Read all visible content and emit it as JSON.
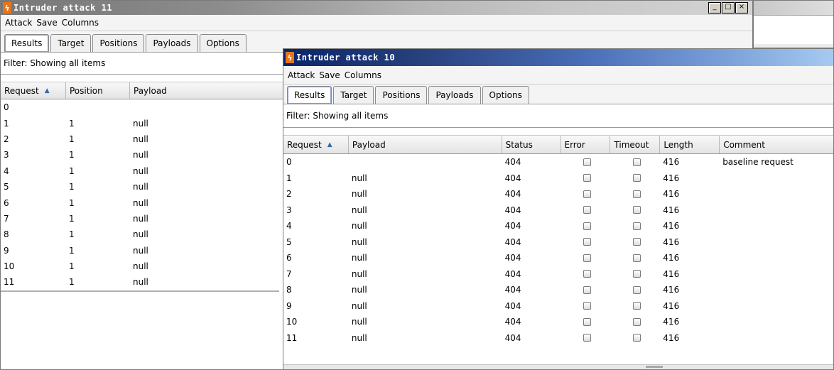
{
  "window_back": {
    "title": "Intruder attack 11",
    "icon": "burp-lightning-icon",
    "controls": [
      "_",
      "□",
      "×"
    ],
    "menu": [
      "Attack",
      "Save",
      "Columns"
    ],
    "tabs": [
      "Results",
      "Target",
      "Positions",
      "Payloads",
      "Options"
    ],
    "active_tab": "Results",
    "filter_text": "Filter: Showing all items",
    "columns": [
      "Request",
      "Position",
      "Payload"
    ],
    "rows": [
      {
        "request": "0",
        "position": "",
        "payload": ""
      },
      {
        "request": "1",
        "position": "1",
        "payload": "null"
      },
      {
        "request": "2",
        "position": "1",
        "payload": "null"
      },
      {
        "request": "3",
        "position": "1",
        "payload": "null"
      },
      {
        "request": "4",
        "position": "1",
        "payload": "null"
      },
      {
        "request": "5",
        "position": "1",
        "payload": "null"
      },
      {
        "request": "6",
        "position": "1",
        "payload": "null"
      },
      {
        "request": "7",
        "position": "1",
        "payload": "null"
      },
      {
        "request": "8",
        "position": "1",
        "payload": "null"
      },
      {
        "request": "9",
        "position": "1",
        "payload": "null"
      },
      {
        "request": "10",
        "position": "1",
        "payload": "null"
      },
      {
        "request": "11",
        "position": "1",
        "payload": "null"
      }
    ]
  },
  "window_front": {
    "title": "Intruder attack 10",
    "icon": "burp-lightning-icon",
    "menu": [
      "Attack",
      "Save",
      "Columns"
    ],
    "tabs": [
      "Results",
      "Target",
      "Positions",
      "Payloads",
      "Options"
    ],
    "active_tab": "Results",
    "filter_text": "Filter: Showing all items",
    "columns": [
      "Request",
      "Payload",
      "Status",
      "Error",
      "Timeout",
      "Length",
      "Comment"
    ],
    "rows": [
      {
        "request": "0",
        "payload": "",
        "status": "404",
        "length": "416",
        "comment": "baseline request"
      },
      {
        "request": "1",
        "payload": "null",
        "status": "404",
        "length": "416",
        "comment": ""
      },
      {
        "request": "2",
        "payload": "null",
        "status": "404",
        "length": "416",
        "comment": ""
      },
      {
        "request": "3",
        "payload": "null",
        "status": "404",
        "length": "416",
        "comment": ""
      },
      {
        "request": "4",
        "payload": "null",
        "status": "404",
        "length": "416",
        "comment": ""
      },
      {
        "request": "5",
        "payload": "null",
        "status": "404",
        "length": "416",
        "comment": ""
      },
      {
        "request": "6",
        "payload": "null",
        "status": "404",
        "length": "416",
        "comment": ""
      },
      {
        "request": "7",
        "payload": "null",
        "status": "404",
        "length": "416",
        "comment": ""
      },
      {
        "request": "8",
        "payload": "null",
        "status": "404",
        "length": "416",
        "comment": ""
      },
      {
        "request": "9",
        "payload": "null",
        "status": "404",
        "length": "416",
        "comment": ""
      },
      {
        "request": "10",
        "payload": "null",
        "status": "404",
        "length": "416",
        "comment": ""
      },
      {
        "request": "11",
        "payload": "null",
        "status": "404",
        "length": "416",
        "comment": ""
      }
    ]
  }
}
